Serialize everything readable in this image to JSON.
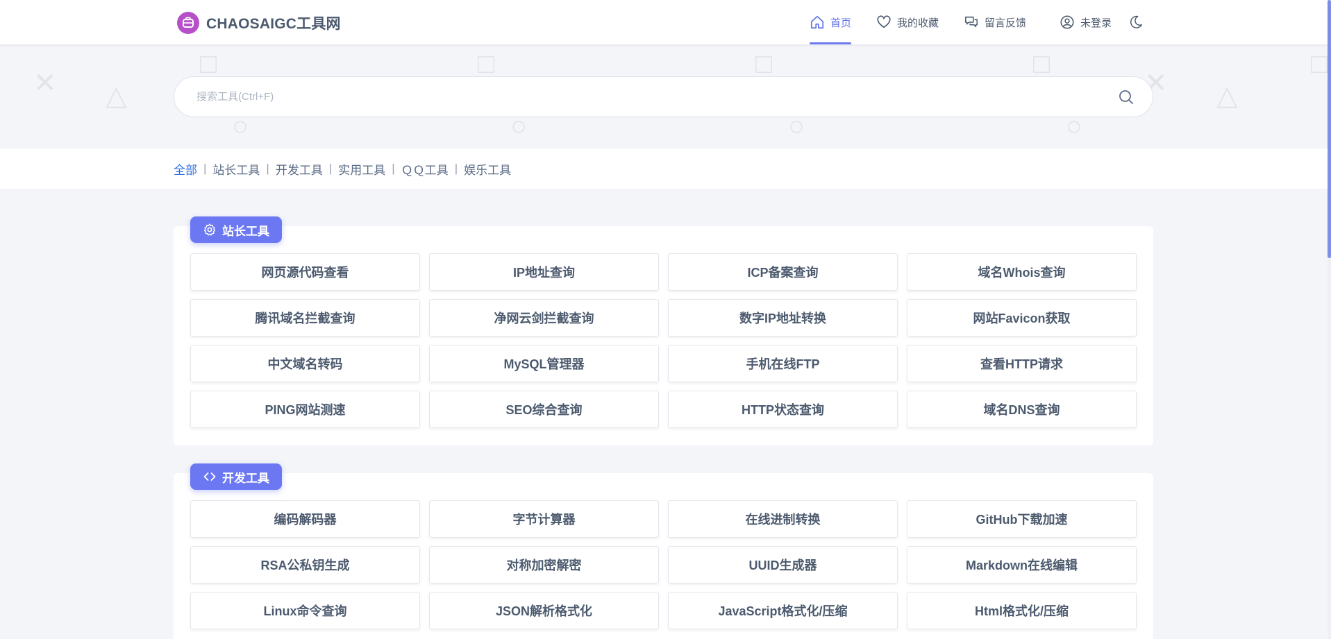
{
  "header": {
    "logo_text": "CHAOSAIGC工具网",
    "nav": [
      {
        "label": "首页",
        "icon": "home-icon",
        "active": true
      },
      {
        "label": "我的收藏",
        "icon": "heart-icon"
      },
      {
        "label": "留言反馈",
        "icon": "chat-icon"
      },
      {
        "label": "未登录",
        "icon": "user-icon"
      }
    ],
    "theme_icon": "moon-icon"
  },
  "search": {
    "placeholder": "搜索工具(Ctrl+F)",
    "value": ""
  },
  "categories": {
    "items": [
      "全部",
      "站长工具",
      "开发工具",
      "实用工具",
      "ＱＱ工具",
      "娱乐工具"
    ],
    "active": "全部",
    "separator": "|"
  },
  "sections": [
    {
      "title": "站长工具",
      "icon": "gear-icon",
      "tools": [
        "网页源代码查看",
        "IP地址查询",
        "ICP备案查询",
        "域名Whois查询",
        "腾讯域名拦截查询",
        "净网云剑拦截查询",
        "数字IP地址转换",
        "网站Favicon获取",
        "中文域名转码",
        "MySQL管理器",
        "手机在线FTP",
        "查看HTTP请求",
        "PING网站测速",
        "SEO综合查询",
        "HTTP状态查询",
        "域名DNS查询"
      ]
    },
    {
      "title": "开发工具",
      "icon": "code-icon",
      "tools": [
        "编码解码器",
        "字节计算器",
        "在线进制转换",
        "GitHub下载加速",
        "RSA公私钥生成",
        "对称加密解密",
        "UUID生成器",
        "Markdown在线编辑",
        "Linux命令查询",
        "JSON解析格式化",
        "JavaScript格式化/压缩",
        "Html格式化/压缩"
      ]
    }
  ],
  "colors": {
    "accent": "#6b78f2",
    "active_category": "#2e6fe0",
    "logo": "#b550c9"
  }
}
